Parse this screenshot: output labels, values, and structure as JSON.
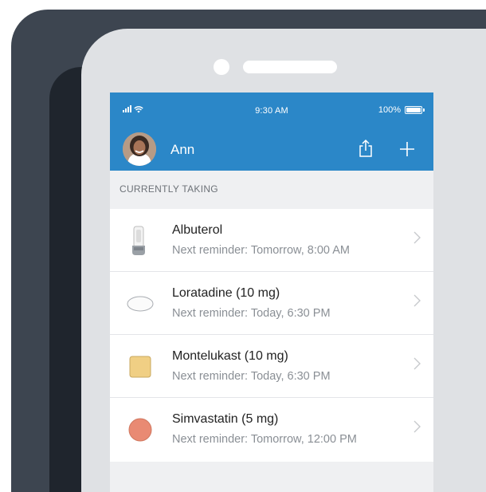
{
  "status_bar": {
    "time": "9:30 AM",
    "battery": "100%"
  },
  "header": {
    "user_name": "Ann"
  },
  "section_title": "CURRENTLY TAKING",
  "medications": [
    {
      "name": "Albuterol",
      "reminder": "Next reminder: Tomorrow, 8:00 AM",
      "icon": "inhaler-icon"
    },
    {
      "name": "Loratadine (10 mg)",
      "reminder": "Next reminder: Today, 6:30 PM",
      "icon": "oval-pill-icon"
    },
    {
      "name": "Montelukast (10 mg)",
      "reminder": "Next reminder: Today, 6:30 PM",
      "icon": "square-pill-icon"
    },
    {
      "name": "Simvastatin (5 mg)",
      "reminder": "Next reminder: Tomorrow, 12:00 PM",
      "icon": "round-pill-icon"
    }
  ],
  "colors": {
    "nav_blue": "#2b87c8",
    "square_pill": "#f0cf84",
    "round_pill": "#e98a73",
    "phone_frame": "#dfe1e4",
    "background_card": "#3d4550"
  }
}
